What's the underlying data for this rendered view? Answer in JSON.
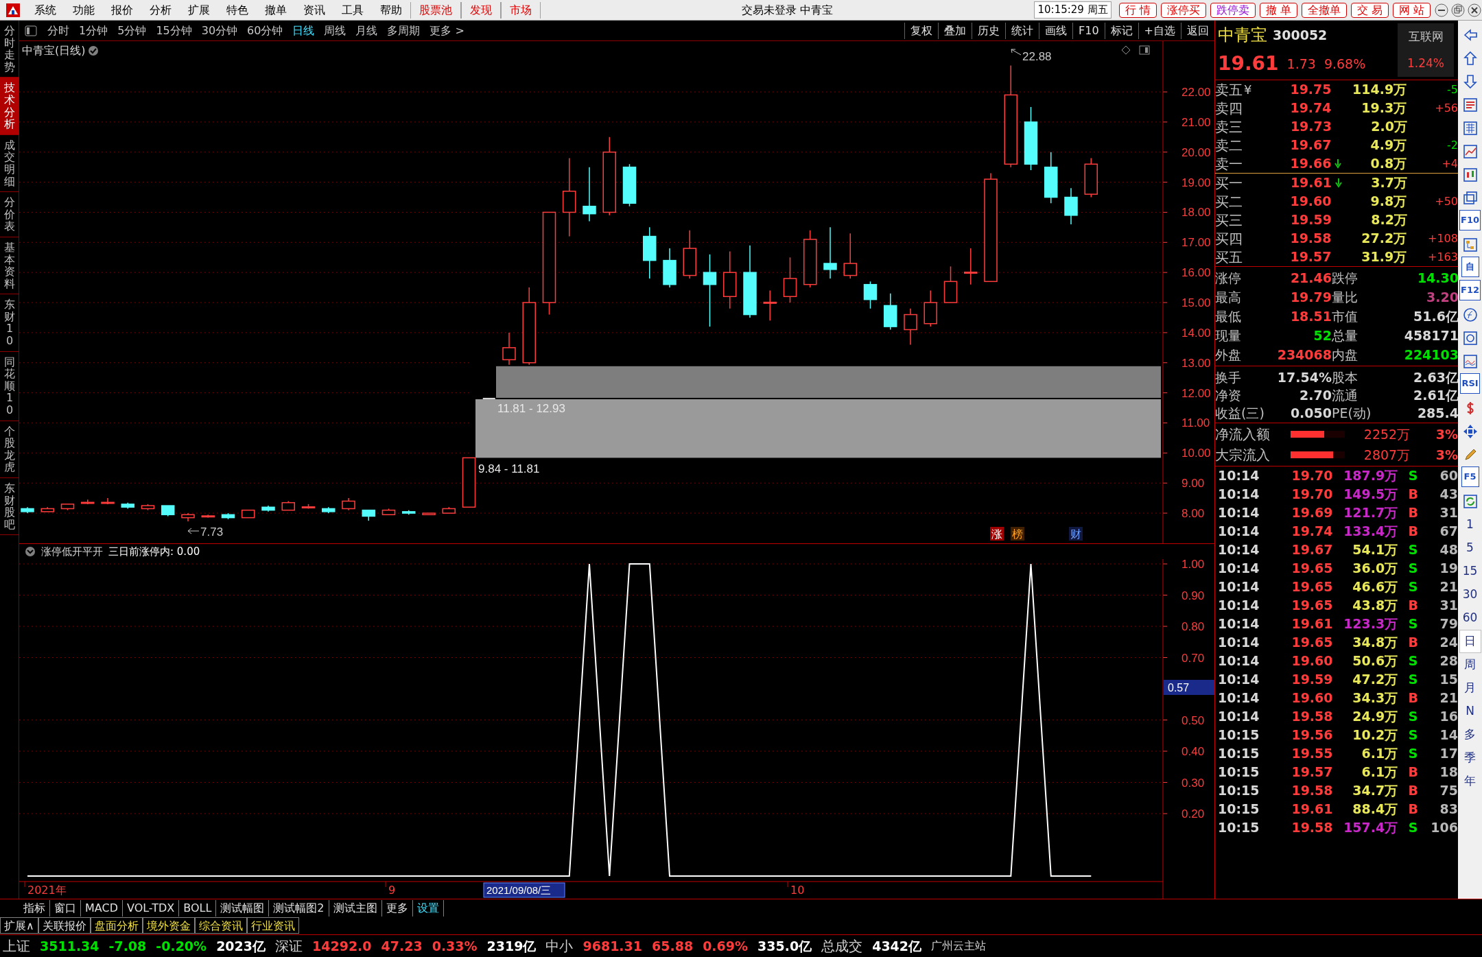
{
  "menu_bar": {
    "menus": [
      {
        "label": "系统",
        "kind": "menu"
      },
      {
        "label": "功能",
        "kind": "menu"
      },
      {
        "label": "报价",
        "kind": "menu"
      },
      {
        "label": "分析",
        "kind": "menu"
      },
      {
        "label": "扩展",
        "kind": "menu"
      },
      {
        "label": "特色",
        "kind": "menu"
      },
      {
        "label": "撤单",
        "kind": "menu"
      },
      {
        "label": "资讯",
        "kind": "menu"
      },
      {
        "label": "工具",
        "kind": "menu"
      },
      {
        "label": "帮助",
        "kind": "menu"
      },
      {
        "label": "股票池",
        "kind": "feature"
      },
      {
        "label": "发现",
        "kind": "feature"
      },
      {
        "label": "市场",
        "kind": "feature"
      }
    ],
    "title": "交易未登录 中青宝",
    "time": "10:15:29 周五",
    "buttons": [
      {
        "label": "行 情",
        "kind": "buy"
      },
      {
        "label": "涨停买",
        "kind": "buy"
      },
      {
        "label": "跌停卖",
        "kind": "sell"
      },
      {
        "label": "撤 单",
        "kind": "buy"
      },
      {
        "label": "全撤单",
        "kind": "buy"
      },
      {
        "label": "交 易",
        "kind": "buy"
      },
      {
        "label": "网 站",
        "kind": "buy"
      }
    ]
  },
  "toolbar": {
    "periods": [
      {
        "label": "分时",
        "selected": false
      },
      {
        "label": "1分钟",
        "selected": false
      },
      {
        "label": "5分钟",
        "selected": false
      },
      {
        "label": "15分钟",
        "selected": false
      },
      {
        "label": "30分钟",
        "selected": false
      },
      {
        "label": "60分钟",
        "selected": false
      },
      {
        "label": "日线",
        "selected": true
      },
      {
        "label": "周线",
        "selected": false
      },
      {
        "label": "月线",
        "selected": false
      },
      {
        "label": "多周期",
        "selected": false
      },
      {
        "label": "更多 >",
        "selected": false
      }
    ],
    "tools": [
      "复权",
      "叠加",
      "历史",
      "统计",
      "画线",
      "F10",
      "标记",
      "+自选",
      "返回"
    ]
  },
  "side_tabs": [
    {
      "label": "分时走势",
      "selected": false
    },
    {
      "label": "技术分析",
      "selected": true
    },
    {
      "label": "成交明细",
      "selected": false
    },
    {
      "label": "分价表",
      "selected": false
    },
    {
      "label": "基本资料",
      "selected": false
    },
    {
      "label": "东财10",
      "selected": false
    },
    {
      "label": "同花顺10",
      "selected": false
    },
    {
      "label": "个股龙虎",
      "selected": false
    },
    {
      "label": "东财股吧",
      "selected": false
    }
  ],
  "price_chart": {
    "title": "中青宝(日线)",
    "axis_ticks": [
      "22.00",
      "21.00",
      "20.00",
      "19.00",
      "18.00",
      "17.00",
      "16.00",
      "15.00",
      "14.00",
      "13.00",
      "12.00",
      "11.00",
      "10.00",
      "9.00",
      "8.00"
    ],
    "high_label": "22.88",
    "low_label": "7.73",
    "gaps": [
      {
        "label": "11.81 - 12.93"
      },
      {
        "label": "9.84 - 11.81"
      }
    ],
    "markers": [
      {
        "label": "涨",
        "kind": "limit"
      },
      {
        "label": "榜",
        "kind": "list"
      },
      {
        "label": "财",
        "kind": "finance"
      }
    ]
  },
  "indicator": {
    "name": "涨停低开平开",
    "reading": "三日前涨停内: 0.00",
    "cursor_value": "0.57",
    "cursor_date": "2021/09/08/三",
    "date_axis": [
      "2021年",
      "9",
      "10"
    ],
    "axis_ticks": [
      "1.00",
      "0.90",
      "0.80",
      "0.70",
      "0.50",
      "0.40",
      "0.30",
      "0.20"
    ]
  },
  "quote": {
    "name": "中青宝",
    "code": "300052",
    "sector": "互联网",
    "sector_change": "1.24%",
    "price": "19.61",
    "change": "1.73",
    "change_pct": "9.68%",
    "asks": [
      {
        "label": "卖五",
        "mark": "¥",
        "price": "19.75",
        "volume": "114.9万",
        "delta": "-5",
        "rising": false,
        "down_tick": false
      },
      {
        "label": "卖四",
        "price": "19.74",
        "volume": "19.3万",
        "delta": "+56",
        "rising": true,
        "down_tick": false
      },
      {
        "label": "卖三",
        "price": "19.73",
        "volume": "2.0万",
        "down_tick": false
      },
      {
        "label": "卖二",
        "price": "19.67",
        "volume": "4.9万",
        "delta": "-2",
        "rising": false,
        "down_tick": false
      },
      {
        "label": "卖一",
        "price": "19.66",
        "volume": "0.8万",
        "delta": "+4",
        "rising": true,
        "down_tick": true
      }
    ],
    "bids": [
      {
        "label": "买一",
        "price": "19.61",
        "volume": "3.7万",
        "down_tick": true
      },
      {
        "label": "买二",
        "price": "19.60",
        "volume": "9.8万",
        "delta": "+50",
        "rising": true,
        "down_tick": false
      },
      {
        "label": "买三",
        "price": "19.59",
        "volume": "8.2万",
        "down_tick": false
      },
      {
        "label": "买四",
        "price": "19.58",
        "volume": "27.2万",
        "delta": "+108",
        "rising": true,
        "down_tick": false
      },
      {
        "label": "买五",
        "price": "19.57",
        "volume": "31.9万",
        "delta": "+163",
        "rising": true,
        "down_tick": false
      }
    ],
    "stats": [
      {
        "label": "涨停",
        "value": "21.46",
        "color": "#ff3c3c"
      },
      {
        "label": "跌停",
        "value": "14.30",
        "color": "#00e000"
      },
      {
        "label": "最高",
        "value": "19.79",
        "color": "#ff3c3c"
      },
      {
        "label": "量比",
        "value": "3.20",
        "color": "#c04080"
      },
      {
        "label": "最低",
        "value": "18.51",
        "color": "#ff3c3c"
      },
      {
        "label": "市值",
        "value": "51.6亿",
        "color": "#d8d8d8"
      },
      {
        "label": "现量",
        "value": "52",
        "color": "#00e000"
      },
      {
        "label": "总量",
        "value": "458171",
        "color": "#d8d8d8"
      },
      {
        "label": "外盘",
        "value": "234068",
        "color": "#ff3c3c"
      },
      {
        "label": "内盘",
        "value": "224103",
        "color": "#00e000"
      }
    ],
    "shares": [
      {
        "label": "换手",
        "value": "17.54%"
      },
      {
        "label": "股本",
        "value": "2.63亿"
      },
      {
        "label": "净资",
        "value": "2.70"
      },
      {
        "label": "流通",
        "value": "2.61亿"
      },
      {
        "label": "收益(三)",
        "value": "0.050"
      },
      {
        "label": "PE(动)",
        "value": "285.4"
      }
    ],
    "flows": [
      {
        "label": "净流入额",
        "level": 0.62,
        "amount": "2252万",
        "pct": "3%"
      },
      {
        "label": "大宗流入",
        "level": 0.78,
        "amount": "2807万",
        "pct": "3%"
      }
    ],
    "trades": [
      {
        "time": "10:14",
        "price": "19.70",
        "volume": "187.9万",
        "large": true,
        "side": "S",
        "buy": false,
        "count": "60"
      },
      {
        "time": "10:14",
        "price": "19.70",
        "volume": "149.5万",
        "large": true,
        "side": "B",
        "buy": true,
        "count": "43"
      },
      {
        "time": "10:14",
        "price": "19.69",
        "volume": "121.7万",
        "large": true,
        "side": "B",
        "buy": true,
        "count": "31"
      },
      {
        "time": "10:14",
        "price": "19.74",
        "volume": "133.4万",
        "large": true,
        "side": "B",
        "buy": true,
        "count": "67"
      },
      {
        "time": "10:14",
        "price": "19.67",
        "volume": "54.1万",
        "large": false,
        "side": "S",
        "buy": false,
        "count": "48"
      },
      {
        "time": "10:14",
        "price": "19.65",
        "volume": "36.0万",
        "large": false,
        "side": "S",
        "buy": false,
        "count": "19"
      },
      {
        "time": "10:14",
        "price": "19.65",
        "volume": "46.6万",
        "large": false,
        "side": "S",
        "buy": false,
        "count": "21"
      },
      {
        "time": "10:14",
        "price": "19.65",
        "volume": "43.8万",
        "large": false,
        "side": "B",
        "buy": true,
        "count": "31"
      },
      {
        "time": "10:14",
        "price": "19.61",
        "volume": "123.3万",
        "large": true,
        "side": "S",
        "buy": false,
        "count": "79"
      },
      {
        "time": "10:14",
        "price": "19.65",
        "volume": "34.8万",
        "large": false,
        "side": "B",
        "buy": true,
        "count": "24"
      },
      {
        "time": "10:14",
        "price": "19.60",
        "volume": "50.6万",
        "large": false,
        "side": "S",
        "buy": false,
        "count": "28"
      },
      {
        "time": "10:14",
        "price": "19.59",
        "volume": "47.2万",
        "large": false,
        "side": "S",
        "buy": false,
        "count": "15"
      },
      {
        "time": "10:14",
        "price": "19.60",
        "volume": "34.3万",
        "large": false,
        "side": "B",
        "buy": true,
        "count": "21"
      },
      {
        "time": "10:14",
        "price": "19.58",
        "volume": "24.9万",
        "large": false,
        "side": "S",
        "buy": false,
        "count": "16"
      },
      {
        "time": "10:15",
        "price": "19.56",
        "volume": "10.2万",
        "large": false,
        "side": "S",
        "buy": false,
        "count": "14"
      },
      {
        "time": "10:15",
        "price": "19.55",
        "volume": "6.1万",
        "large": false,
        "side": "S",
        "buy": false,
        "count": "17"
      },
      {
        "time": "10:15",
        "price": "19.57",
        "volume": "6.1万",
        "large": false,
        "side": "B",
        "buy": true,
        "count": "18"
      },
      {
        "time": "10:15",
        "price": "19.58",
        "volume": "34.7万",
        "large": false,
        "side": "B",
        "buy": true,
        "count": "75"
      },
      {
        "time": "10:15",
        "price": "19.61",
        "volume": "88.4万",
        "large": false,
        "side": "B",
        "buy": true,
        "count": "83"
      },
      {
        "time": "10:15",
        "price": "19.58",
        "volume": "157.4万",
        "large": true,
        "side": "S",
        "buy": false,
        "count": "106"
      }
    ]
  },
  "side_toolbar": {
    "tool_labels": [
      "F10",
      "自",
      "F12",
      "RSI",
      "F5"
    ],
    "periods": [
      {
        "label": "1",
        "selected": false
      },
      {
        "label": "5",
        "selected": false
      },
      {
        "label": "15",
        "selected": false
      },
      {
        "label": "30",
        "selected": false
      },
      {
        "label": "60",
        "selected": false
      },
      {
        "label": "日",
        "selected": true
      },
      {
        "label": "周",
        "selected": false
      },
      {
        "label": "月",
        "selected": false
      },
      {
        "label": "N",
        "selected": false
      },
      {
        "label": "多",
        "selected": false
      },
      {
        "label": "季",
        "selected": false
      },
      {
        "label": "年",
        "selected": false
      }
    ]
  },
  "bottom_tabs": [
    {
      "label": "指标",
      "kind": "tab"
    },
    {
      "label": "窗口",
      "kind": "tab"
    },
    {
      "label": "MACD",
      "kind": "tab"
    },
    {
      "label": "VOL-TDX",
      "kind": "tab"
    },
    {
      "label": "BOLL",
      "kind": "tab"
    },
    {
      "label": "测试幅图",
      "kind": "tab"
    },
    {
      "label": "测试幅图2",
      "kind": "tab"
    },
    {
      "label": "测试主图",
      "kind": "tab"
    },
    {
      "label": "更多",
      "kind": "tab"
    },
    {
      "label": "设置",
      "kind": "action"
    }
  ],
  "extension_tabs": [
    {
      "label": "扩展∧",
      "highlighted": false
    },
    {
      "label": "关联报价",
      "highlighted": false
    },
    {
      "label": "盘面分析",
      "highlighted": true
    },
    {
      "label": "境外资金",
      "highlighted": true
    },
    {
      "label": "综合资讯",
      "highlighted": true
    },
    {
      "label": "行业资讯",
      "highlighted": true
    }
  ],
  "status_bar": {
    "indices": [
      {
        "name": "上证",
        "value": "3511.34",
        "change": "-7.08",
        "pct": "-0.20%",
        "amount": "2023亿",
        "rising": false
      },
      {
        "name": "深证",
        "value": "14292.0",
        "change": "47.23",
        "pct": "0.33%",
        "amount": "2319亿",
        "rising": true
      },
      {
        "name": "中小",
        "value": "9681.31",
        "change": "65.88",
        "pct": "0.69%",
        "amount": "335.0亿",
        "rising": true
      }
    ],
    "total_label": "总成交",
    "total": "4342亿",
    "server": "广州云主站"
  }
}
